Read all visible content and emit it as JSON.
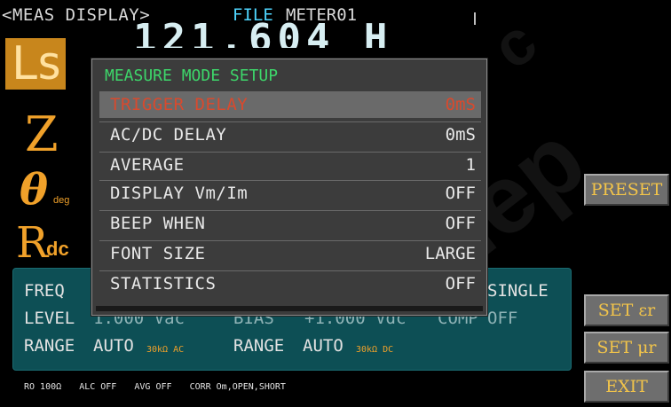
{
  "header": {
    "title": "<MEAS DISPLAY>",
    "file_label": "FILE",
    "file_name": "METER01"
  },
  "main_value_peek": "121.604  H",
  "params": {
    "primary": "Ls",
    "secondary": "Z",
    "theta": "θ",
    "theta_sub": "deg",
    "dc": "R",
    "dc_sub": "dc"
  },
  "panel": {
    "freq_label": "FREQ",
    "trigger_tail": "SINGLE",
    "level_label": "LEVEL",
    "level_value": "1.000 Vac",
    "bias_label": "BIAS",
    "bias_value": "+1.000 Vdc",
    "comp_label": "COMP",
    "comp_value": "OFF",
    "range1_label": "RANGE",
    "range1_value": "AUTO",
    "range1_unit": "30kΩ AC",
    "range2_label": "RANGE",
    "range2_value": "AUTO",
    "range2_unit": "30kΩ DC"
  },
  "buttons": {
    "preset": "PRESET",
    "set_er": "SET εr",
    "set_ur": "SET μr",
    "exit": "EXIT"
  },
  "status": {
    "ro": "RO 100Ω",
    "alc": "ALC OFF",
    "avg": "AVG OFF",
    "corr": "CORR Om,OPEN,SHORT"
  },
  "dialog": {
    "title": "MEASURE MODE SETUP",
    "rows": [
      {
        "label": "TRIGGER DELAY",
        "value": "0mS"
      },
      {
        "label": "AC/DC DELAY",
        "value": "0mS"
      },
      {
        "label": "AVERAGE",
        "value": "1"
      },
      {
        "label": "DISPLAY Vm/Im",
        "value": "OFF"
      },
      {
        "label": "BEEP WHEN",
        "value": "OFF"
      },
      {
        "label": "FONT SIZE",
        "value": "LARGE"
      },
      {
        "label": "STATISTICS",
        "value": "OFF"
      }
    ],
    "selected_index": 0
  },
  "watermark": "супер",
  "colors": {
    "accent_orange": "#f0a12a",
    "header_cyan": "#4fd6ff",
    "title_green": "#3dd66a",
    "selected_red": "#d84a2e",
    "panel_teal": "#0d4f55"
  }
}
